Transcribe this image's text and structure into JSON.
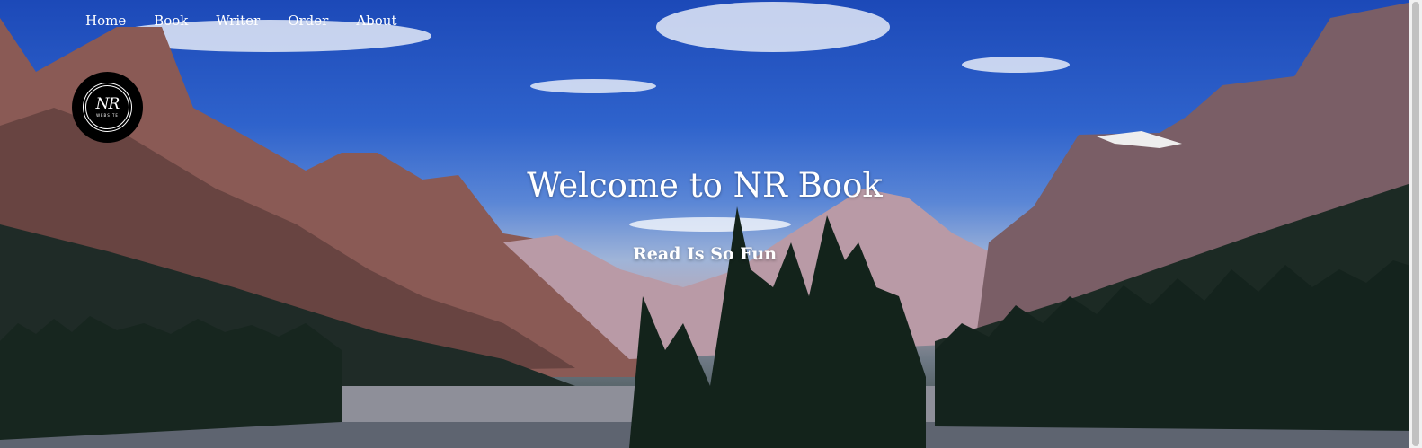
{
  "nav": {
    "items": [
      {
        "label": "Home"
      },
      {
        "label": "Book"
      },
      {
        "label": "Writer"
      },
      {
        "label": "Order"
      },
      {
        "label": "About"
      }
    ]
  },
  "logo": {
    "mark": "NR",
    "sub": "WEBSITE"
  },
  "hero": {
    "headline": "Welcome to NR Book",
    "tagline": "Read Is So Fun"
  }
}
